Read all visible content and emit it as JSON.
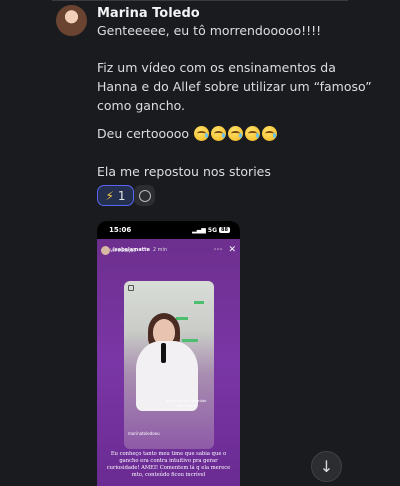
{
  "message": {
    "author": "Marina Toledo",
    "line1": "Genteeeee, eu tô morrendooooo!!!!",
    "para2": "Fiz um vídeo com os ensinamentos da Hanna e do Allef sobre utilizar um “famoso” como gancho.",
    "para3": "Deu certooooo",
    "para3_emoji_icon": "face-holding-back-tears",
    "para4": "Ela me repostou nos stories"
  },
  "reactions": [
    {
      "emoji": "⚡",
      "count": "1"
    }
  ],
  "story": {
    "time": "15:06",
    "signal": "5G",
    "battery": "88",
    "username": "isabelamatte",
    "age": "2 min",
    "subtitle": "Ver tradução",
    "card_caption": "Hoje é dia de conteúdo com uma IA",
    "card_handle": "marinatoledoeu",
    "caption": "Eu conheço tanto meu time que sabia que o gancho era contra intuitivo pra gerar curiosidade! AMEI! Comentem lá q ela merece mto, conteúdo ficou incrível"
  },
  "scroll_button_icon": "arrow-down-icon"
}
